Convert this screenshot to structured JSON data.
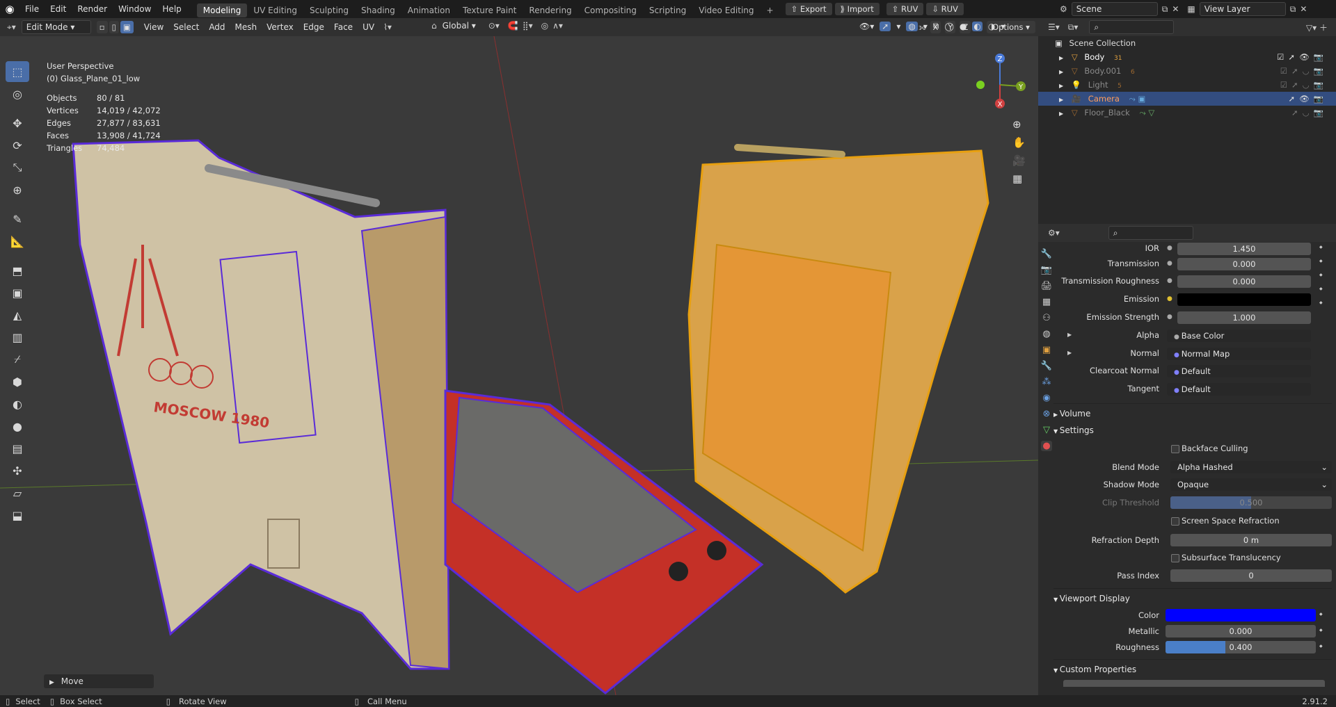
{
  "topbar": {
    "menu": [
      "File",
      "Edit",
      "Render",
      "Window",
      "Help"
    ],
    "workspaces": [
      "Modeling",
      "UV Editing",
      "Sculpting",
      "Shading",
      "Animation",
      "Texture Paint",
      "Rendering",
      "Compositing",
      "Scripting",
      "Video Editing"
    ],
    "active_workspace": "Modeling",
    "add_tab": "+",
    "export_label": "Export",
    "import_label": "Import",
    "ruv1_label": "RUV",
    "ruv2_label": "RUV",
    "scene_label": "Scene",
    "view_layer_label": "View Layer"
  },
  "viewport_header": {
    "mode": "Edit Mode",
    "menus": [
      "View",
      "Select",
      "Add",
      "Mesh",
      "Vertex",
      "Edge",
      "Face",
      "UV"
    ],
    "orientation": "Global",
    "options_label": "Options",
    "axes": [
      "X",
      "Y",
      "Z"
    ]
  },
  "viewport": {
    "perspective": "User Perspective",
    "object_name": "(0) Glass_Plane_01_low",
    "stats": [
      {
        "label": "Objects",
        "value": "80 / 81"
      },
      {
        "label": "Vertices",
        "value": "14,019 / 42,072"
      },
      {
        "label": "Edges",
        "value": "27,877 / 83,631"
      },
      {
        "label": "Faces",
        "value": "13,908 / 41,724"
      },
      {
        "label": "Triangles",
        "value": "74,484"
      }
    ],
    "operator_panel": "Move",
    "gizmo": {
      "x": "X",
      "y": "Y",
      "z": "Z"
    }
  },
  "outliner": {
    "root": "Scene Collection",
    "items": [
      {
        "name": "Body",
        "badge": "31",
        "selected": false,
        "color": "#ffffff"
      },
      {
        "name": "Body.001",
        "badge": "6",
        "selected": false,
        "color": "#8a8a8a"
      },
      {
        "name": "Light",
        "badge": "5",
        "selected": false,
        "color": "#8a8a8a"
      },
      {
        "name": "Camera",
        "badge": "",
        "selected": true,
        "color": "#ff9d5c"
      },
      {
        "name": "Floor_Black",
        "badge": "",
        "selected": false,
        "color": "#8a8a8a"
      }
    ]
  },
  "properties": {
    "fields": [
      {
        "label": "IOR",
        "value": "1.450"
      },
      {
        "label": "Transmission",
        "value": "0.000"
      },
      {
        "label": "Transmission Roughness",
        "value": "0.000"
      },
      {
        "label": "Emission",
        "value": ""
      },
      {
        "label": "Emission Strength",
        "value": "1.000"
      },
      {
        "label": "Alpha",
        "value": "Base Color"
      },
      {
        "label": "Normal",
        "value": "Normal Map"
      },
      {
        "label": "Clearcoat Normal",
        "value": "Default"
      },
      {
        "label": "Tangent",
        "value": "Default"
      }
    ],
    "volume_panel": "Volume",
    "settings_panel": "Settings",
    "backface_culling": "Backface Culling",
    "blend_mode_label": "Blend Mode",
    "blend_mode_value": "Alpha Hashed",
    "shadow_mode_label": "Shadow Mode",
    "shadow_mode_value": "Opaque",
    "clip_threshold_label": "Clip Threshold",
    "clip_threshold_value": "0.500",
    "clip_threshold_fill": 0.5,
    "ssr_label": "Screen Space Refraction",
    "refraction_depth_label": "Refraction Depth",
    "refraction_depth_value": "0 m",
    "subsurface_label": "Subsurface Translucency",
    "pass_index_label": "Pass Index",
    "pass_index_value": "0",
    "viewport_display_panel": "Viewport Display",
    "color_label": "Color",
    "viewport_color": "#0000ff",
    "metallic_label": "Metallic",
    "metallic_value": "0.000",
    "roughness_label": "Roughness",
    "roughness_value": "0.400",
    "roughness_fill": 0.4,
    "custom_props_panel": "Custom Properties"
  },
  "statusbar": {
    "select": "Select",
    "box_select": "Box Select",
    "rotate_view": "Rotate View",
    "call_menu": "Call Menu",
    "version": "2.91.2"
  },
  "colors": {
    "accent_blue": "#4a6ea8",
    "selected_row": "#334d80",
    "wire_purple": "#5a2bd8",
    "active_orange": "#e8a010"
  }
}
